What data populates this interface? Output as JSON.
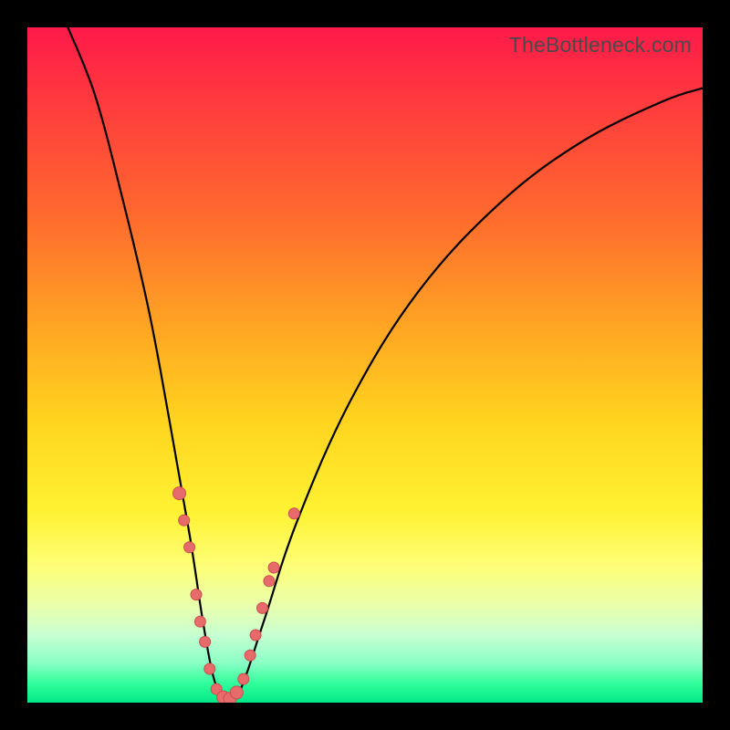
{
  "watermark": "TheBottleneck.com",
  "chart_data": {
    "type": "line",
    "title": "",
    "xlabel": "",
    "ylabel": "",
    "xlim": [
      0,
      100
    ],
    "ylim": [
      0,
      100
    ],
    "curve": [
      {
        "x": 6,
        "y": 100
      },
      {
        "x": 10,
        "y": 90
      },
      {
        "x": 14,
        "y": 75
      },
      {
        "x": 18,
        "y": 58
      },
      {
        "x": 21,
        "y": 42
      },
      {
        "x": 24,
        "y": 25
      },
      {
        "x": 26,
        "y": 12
      },
      {
        "x": 27.5,
        "y": 4
      },
      {
        "x": 29,
        "y": 0.5
      },
      {
        "x": 30.5,
        "y": 0.5
      },
      {
        "x": 32,
        "y": 3
      },
      {
        "x": 35,
        "y": 12
      },
      {
        "x": 40,
        "y": 27
      },
      {
        "x": 48,
        "y": 45
      },
      {
        "x": 58,
        "y": 61
      },
      {
        "x": 70,
        "y": 74
      },
      {
        "x": 82,
        "y": 83
      },
      {
        "x": 94,
        "y": 89
      },
      {
        "x": 100,
        "y": 91
      }
    ],
    "points": [
      {
        "x": 22.5,
        "y": 31,
        "r": 7
      },
      {
        "x": 23.2,
        "y": 27,
        "r": 6
      },
      {
        "x": 24.0,
        "y": 23,
        "r": 6
      },
      {
        "x": 25.0,
        "y": 16,
        "r": 6
      },
      {
        "x": 25.6,
        "y": 12,
        "r": 6
      },
      {
        "x": 26.3,
        "y": 9,
        "r": 6
      },
      {
        "x": 27.0,
        "y": 5,
        "r": 6
      },
      {
        "x": 28.0,
        "y": 2,
        "r": 6
      },
      {
        "x": 29.0,
        "y": 0.8,
        "r": 7
      },
      {
        "x": 30.0,
        "y": 0.6,
        "r": 7
      },
      {
        "x": 31.0,
        "y": 1.5,
        "r": 7
      },
      {
        "x": 32.0,
        "y": 3.5,
        "r": 6
      },
      {
        "x": 33.0,
        "y": 7,
        "r": 6
      },
      {
        "x": 33.8,
        "y": 10,
        "r": 6
      },
      {
        "x": 34.8,
        "y": 14,
        "r": 6
      },
      {
        "x": 35.8,
        "y": 18,
        "r": 6
      },
      {
        "x": 36.5,
        "y": 20,
        "r": 6
      },
      {
        "x": 39.5,
        "y": 28,
        "r": 6
      }
    ]
  }
}
